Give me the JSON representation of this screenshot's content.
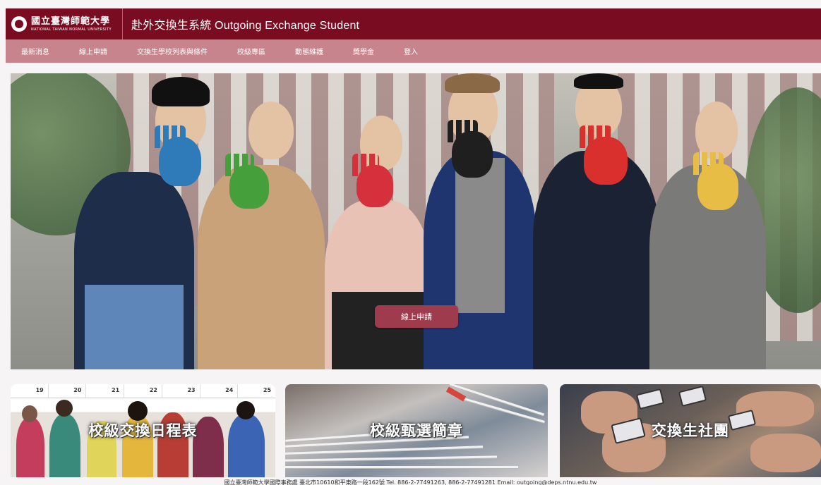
{
  "header": {
    "logo_cn": "國立臺灣師範大學",
    "logo_en": "NATIONAL TAIWAN NORMAL UNIVERSITY",
    "site_title": "赴外交換生系統 Outgoing Exchange Student"
  },
  "nav": {
    "items": [
      {
        "label": "最新消息"
      },
      {
        "label": "線上申請"
      },
      {
        "label": "交換生學校列表與條件"
      },
      {
        "label": "校級專區"
      },
      {
        "label": "動態維護"
      },
      {
        "label": "獎學金"
      },
      {
        "label": "登入"
      }
    ]
  },
  "hero": {
    "apply_button": "線上申請",
    "hand_colors": [
      "#2f7ab8",
      "#45a03c",
      "#d6303c",
      "#1f1f1f",
      "#d9302e",
      "#e7bd45"
    ]
  },
  "cards": [
    {
      "title": "校級交換日程表",
      "calendar_days": [
        "19",
        "20",
        "21",
        "22",
        "23",
        "24",
        "25"
      ]
    },
    {
      "title": "校級甄選簡章"
    },
    {
      "title": "交換生社團"
    }
  ],
  "footer": {
    "text": "國立臺灣師範大學國際事務處 臺北市10610和平東路一段162號  Tel. 886-2-77491263, 886-2-77491281   Email: outgoing@deps.ntnu.edu.tw"
  },
  "colors": {
    "brand": "#7a0c22",
    "nav_bg": "#c7848c",
    "button": "#9e3c4e"
  }
}
